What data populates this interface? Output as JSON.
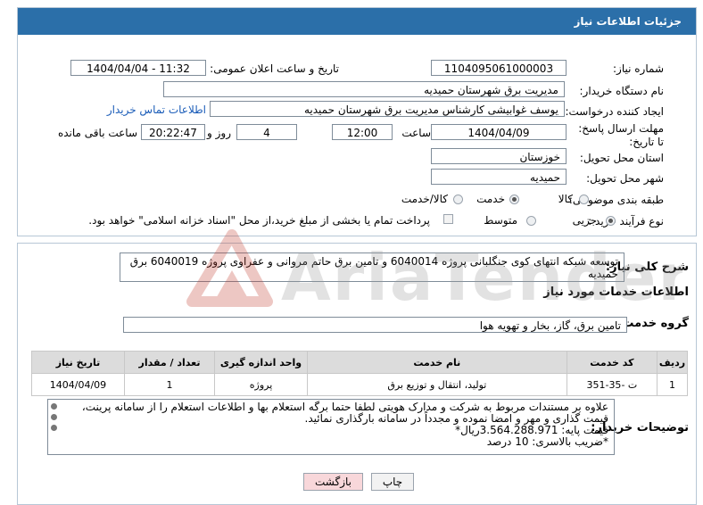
{
  "header": {
    "title": "جزئیات اطلاعات نیاز"
  },
  "fields": {
    "need_number_label": "شماره نیاز:",
    "need_number": "1104095061000003",
    "announce_label": "تاریخ و ساعت اعلان عمومی:",
    "announce_value": "1404/04/04 - 11:32",
    "buyer_org_label": "نام دستگاه خریدار:",
    "buyer_org": "مدیریت برق شهرستان حمیدیه",
    "creator_label": "ایجاد کننده درخواست:",
    "creator": "یوسف غوابیشی کارشناس مدیریت برق شهرستان حمیدیه",
    "contact_link": "اطلاعات تماس خریدار",
    "deadline_label": "مهلت ارسال پاسخ: تا تاریخ:",
    "deadline_date": "1404/04/09",
    "time_label": "ساعت",
    "deadline_time": "12:00",
    "days_value": "4",
    "days_label": "روز و",
    "remaining_time": "20:22:47",
    "remaining_label": "ساعت باقی مانده",
    "province_label": "استان محل تحویل:",
    "province": "خوزستان",
    "city_label": "شهر محل تحویل:",
    "city": "حمیدیه",
    "category_label": "طبقه بندی موضوعی:",
    "category_options": [
      "کالا",
      "خدمت",
      "کالا/خدمت"
    ],
    "category_selected": "خدمت",
    "process_label": "نوع فرآیند خرید :",
    "process_options": [
      "جزیی",
      "متوسط"
    ],
    "process_selected": "جزیی",
    "payment_note": "پرداخت تمام یا بخشی از مبلغ خرید،از محل \"اسناد خزانه اسلامی\" خواهد بود."
  },
  "summary": {
    "label": "شرح کلی نیاز:",
    "text": "توسعه شبکه انتهای کوی جنگلبانی پروژه 6040014 و تامین برق حاتم مروانی و عفراوی پروژه 6040019 برق حمیدیه"
  },
  "services": {
    "section_title": "اطلاعات خدمات مورد نیاز",
    "group_label": "گروه خدمت:",
    "group_value": "تامین برق، گاز، بخار و تهویه هوا",
    "columns": [
      "ردیف",
      "کد خدمت",
      "نام خدمت",
      "واحد اندازه گیری",
      "تعداد / مقدار",
      "تاریخ نیاز"
    ],
    "rows": [
      {
        "row": "1",
        "code": "ت -35-351",
        "name": "تولید، انتقال و توزیع برق",
        "unit": "پروژه",
        "qty": "1",
        "date": "1404/04/09"
      }
    ]
  },
  "notes": {
    "label": "توضیحات خریدار:",
    "lines": [
      "علاوه بر مستندات مربوط به شرکت و مدارک هویتی لطفا حتما برگه استعلام بها و اطلاعات استعلام را از سامانه پرینت،",
      "قیمت گذاری و مهر و امضا نموده و مجدداً در سامانه بارگذاری نمائید.",
      "قیمت پایه: 3.564.288.971ریال*",
      "*ضریب بالاسری:  10 درصد"
    ]
  },
  "buttons": {
    "print": "چاپ",
    "back": "بازگشت"
  },
  "watermark": {
    "text": "AriaTender.neT"
  },
  "colors": {
    "header_bg": "#2b6fa9",
    "link": "#1a5cb8",
    "back_btn_bg": "#f8d7da",
    "watermark": "#c0392b"
  }
}
